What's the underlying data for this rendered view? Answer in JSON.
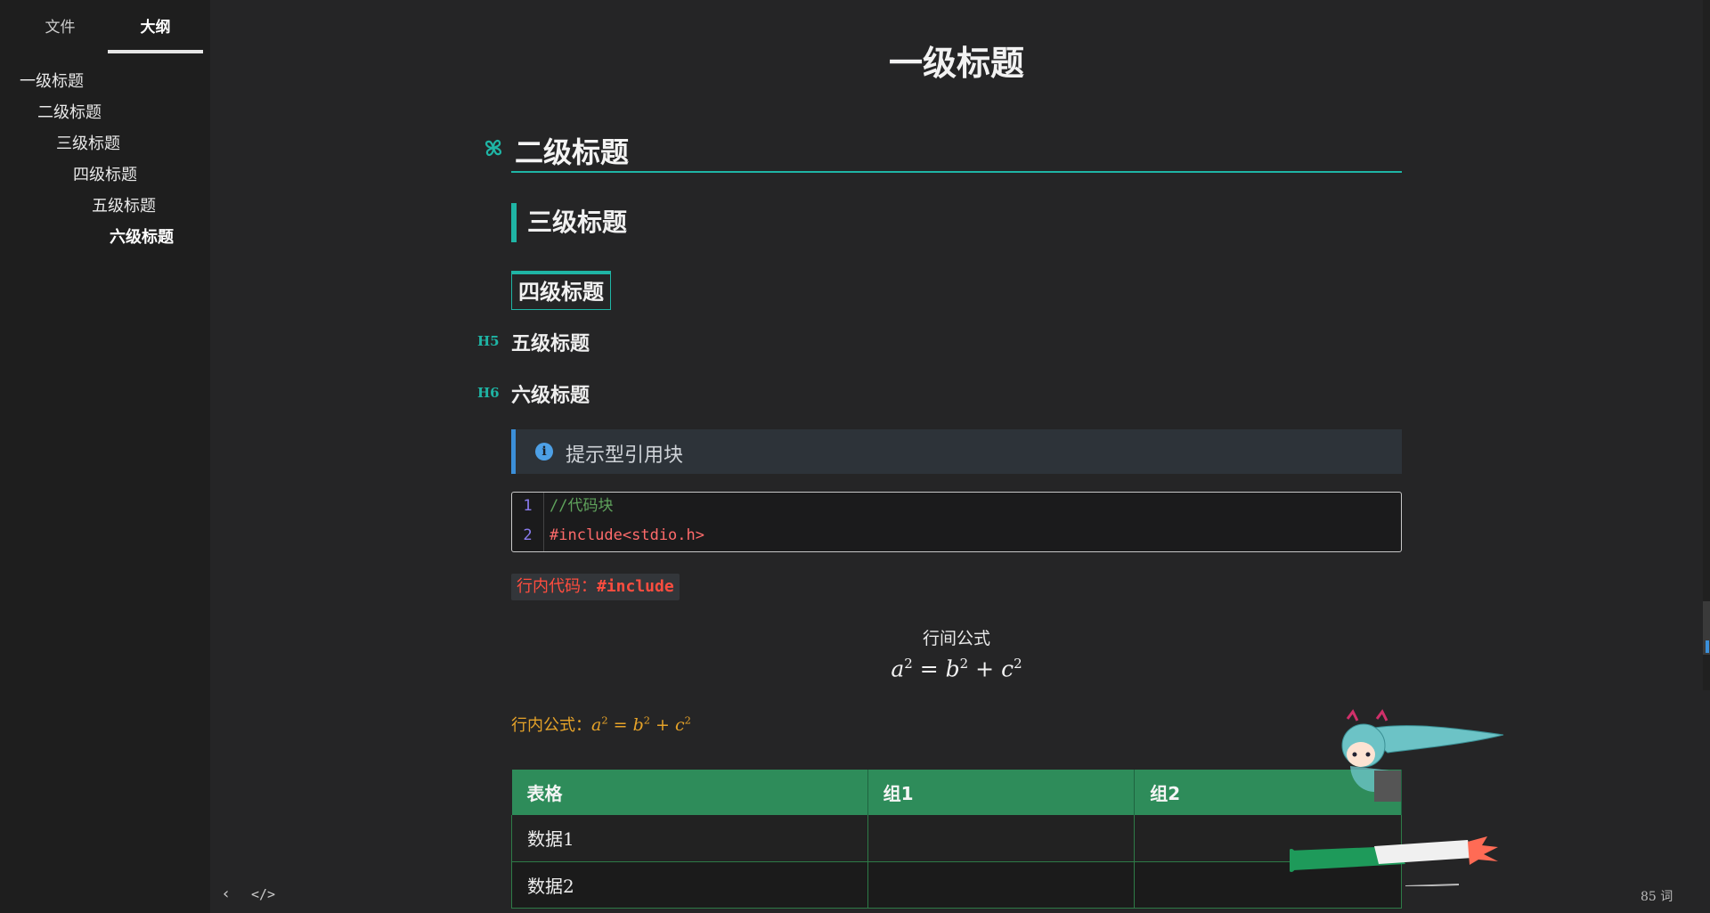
{
  "sidebar": {
    "tabs": [
      {
        "label": "文件"
      },
      {
        "label": "大纲"
      }
    ],
    "outline": [
      {
        "label": "一级标题"
      },
      {
        "label": "二级标题"
      },
      {
        "label": "三级标题"
      },
      {
        "label": "四级标题"
      },
      {
        "label": "五级标题"
      },
      {
        "label": "六级标题"
      }
    ]
  },
  "doc": {
    "h1": "一级标题",
    "h2": "二级标题",
    "h3": "三级标题",
    "h4": "四级标题",
    "h5": "五级标题",
    "h6": "六级标题",
    "h5_marker": "H5",
    "h6_marker": "H6",
    "callout": {
      "icon": "i",
      "text": "提示型引用块"
    },
    "code": {
      "line_numbers": [
        "1",
        "2"
      ],
      "lines": [
        "//代码块",
        "#include<stdio.h>"
      ]
    },
    "inline_code": {
      "label": "行内代码：",
      "code": "#include"
    },
    "display_formula": {
      "title": "行间公式",
      "a": "a",
      "b": "b",
      "c": "c",
      "exp": "2",
      "eq": " = ",
      "plus": " + "
    },
    "inline_formula_label": "行内公式：",
    "table": {
      "headers": [
        "表格",
        "组1",
        "组2"
      ],
      "rows": [
        [
          "数据1",
          "",
          ""
        ],
        [
          "数据2",
          "",
          ""
        ]
      ]
    }
  },
  "footer": {
    "back": "‹",
    "source": "</>",
    "word_count": "85 词"
  },
  "colors": {
    "accent": "#1fb5a5",
    "table_header": "#2e8c5a",
    "inline_code": "#ff4d3f",
    "callout_bar": "#3b8fd9"
  },
  "icons": [
    "pinwheel-icon",
    "info-icon",
    "chevron-left-icon",
    "code-source-icon"
  ]
}
